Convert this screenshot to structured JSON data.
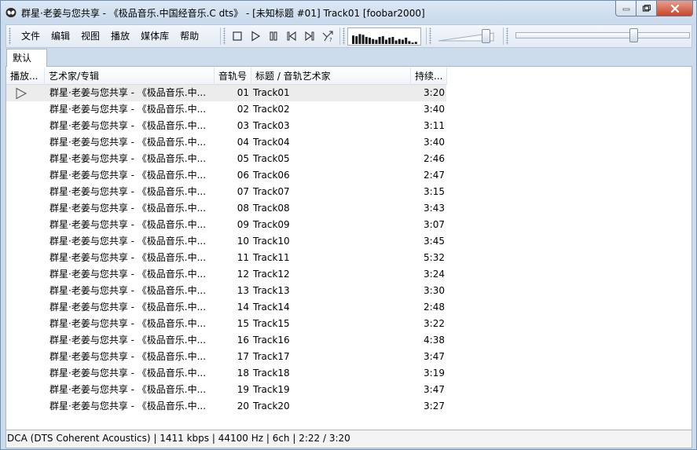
{
  "window": {
    "title": "群星·老姜与您共享 - 《极品音乐.中国经音乐.C dts》 - [未知标题 #01] Track01  [foobar2000]"
  },
  "menu": [
    "文件",
    "编辑",
    "视图",
    "播放",
    "媒体库",
    "帮助"
  ],
  "tabs": [
    {
      "label": "默认"
    }
  ],
  "spectrum_levels": [
    0.6,
    0.55,
    0.7,
    0.65,
    0.5,
    0.45,
    0.35,
    0.3,
    0.5,
    0.55,
    0.3,
    0.45,
    0.5,
    0.25,
    0.35,
    0.3,
    0.45,
    0.2,
    0.1,
    0.15
  ],
  "volume_level": 0.85,
  "seek_position": 0.69,
  "columns": {
    "playing": "播放...",
    "artist_album": "艺术家/专辑",
    "track_no": "音轨号",
    "title_artist": "标题 / 音轨艺术家",
    "duration": "持续..."
  },
  "playlist": [
    {
      "artist_album": "群星·老姜与您共享 - 《极品音乐.中...",
      "track_no": "01",
      "title": "Track01",
      "duration": "3:20",
      "playing": true
    },
    {
      "artist_album": "群星·老姜与您共享 - 《极品音乐.中...",
      "track_no": "02",
      "title": "Track02",
      "duration": "3:40"
    },
    {
      "artist_album": "群星·老姜与您共享 - 《极品音乐.中...",
      "track_no": "03",
      "title": "Track03",
      "duration": "3:11"
    },
    {
      "artist_album": "群星·老姜与您共享 - 《极品音乐.中...",
      "track_no": "04",
      "title": "Track04",
      "duration": "3:40"
    },
    {
      "artist_album": "群星·老姜与您共享 - 《极品音乐.中...",
      "track_no": "05",
      "title": "Track05",
      "duration": "2:46"
    },
    {
      "artist_album": "群星·老姜与您共享 - 《极品音乐.中...",
      "track_no": "06",
      "title": "Track06",
      "duration": "2:47"
    },
    {
      "artist_album": "群星·老姜与您共享 - 《极品音乐.中...",
      "track_no": "07",
      "title": "Track07",
      "duration": "3:15"
    },
    {
      "artist_album": "群星·老姜与您共享 - 《极品音乐.中...",
      "track_no": "08",
      "title": "Track08",
      "duration": "3:43"
    },
    {
      "artist_album": "群星·老姜与您共享 - 《极品音乐.中...",
      "track_no": "09",
      "title": "Track09",
      "duration": "3:07"
    },
    {
      "artist_album": "群星·老姜与您共享 - 《极品音乐.中...",
      "track_no": "10",
      "title": "Track10",
      "duration": "3:45"
    },
    {
      "artist_album": "群星·老姜与您共享 - 《极品音乐.中...",
      "track_no": "11",
      "title": "Track11",
      "duration": "5:32"
    },
    {
      "artist_album": "群星·老姜与您共享 - 《极品音乐.中...",
      "track_no": "12",
      "title": "Track12",
      "duration": "3:24"
    },
    {
      "artist_album": "群星·老姜与您共享 - 《极品音乐.中...",
      "track_no": "13",
      "title": "Track13",
      "duration": "3:30"
    },
    {
      "artist_album": "群星·老姜与您共享 - 《极品音乐.中...",
      "track_no": "14",
      "title": "Track14",
      "duration": "2:48"
    },
    {
      "artist_album": "群星·老姜与您共享 - 《极品音乐.中...",
      "track_no": "15",
      "title": "Track15",
      "duration": "3:22"
    },
    {
      "artist_album": "群星·老姜与您共享 - 《极品音乐.中...",
      "track_no": "16",
      "title": "Track16",
      "duration": "4:38"
    },
    {
      "artist_album": "群星·老姜与您共享 - 《极品音乐.中...",
      "track_no": "17",
      "title": "Track17",
      "duration": "3:47"
    },
    {
      "artist_album": "群星·老姜与您共享 - 《极品音乐.中...",
      "track_no": "18",
      "title": "Track18",
      "duration": "3:19"
    },
    {
      "artist_album": "群星·老姜与您共享 - 《极品音乐.中...",
      "track_no": "19",
      "title": "Track19",
      "duration": "3:47"
    },
    {
      "artist_album": "群星·老姜与您共享 - 《极品音乐.中...",
      "track_no": "20",
      "title": "Track20",
      "duration": "3:27"
    }
  ],
  "status": "DCA (DTS Coherent Acoustics) | 1411 kbps | 44100 Hz | 6ch | 2:22 / 3:20"
}
